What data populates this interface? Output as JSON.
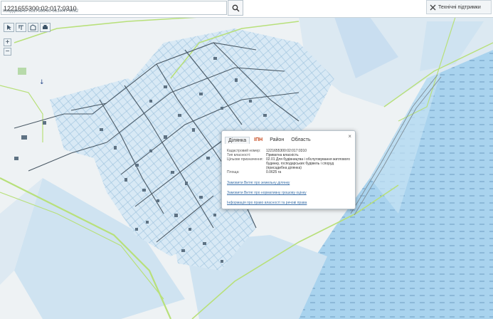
{
  "search": {
    "value": "1221655300:02:017:0310"
  },
  "coords": {
    "text": "Координати: 5227989.80 6134/47 6062"
  },
  "tools": {
    "label": "Технічні підтримки"
  },
  "zoom": {
    "in": "+",
    "out": "−"
  },
  "popup": {
    "tabs": [
      "Ділянка",
      "ІПН",
      "Район",
      "Область"
    ],
    "close": "×",
    "rows": [
      {
        "k": "Кадастровий номер:",
        "v": "1221655300:02:017:0310"
      },
      {
        "k": "Тип власності:",
        "v": "Приватна власність"
      },
      {
        "k": "Цільове призначення:",
        "v": "02.01 Для будівництва і обслуговування житлового будинку, господарських будівель і споруд (присадибна ділянка)"
      },
      {
        "k": "Площа:",
        "v": "0.0625 га"
      }
    ],
    "links": [
      "Замовити Витяг про земельну ділянку",
      "Замовити Витяг про нормативну грошову оцінку",
      "Інформація про право власності та речові права"
    ]
  },
  "colors": {
    "water": "#a9d3ee",
    "parcel_line": "#8fb8d8",
    "road": "#b8e07a",
    "building": "#5e7283",
    "popup_highlight": "#c64a1f"
  }
}
